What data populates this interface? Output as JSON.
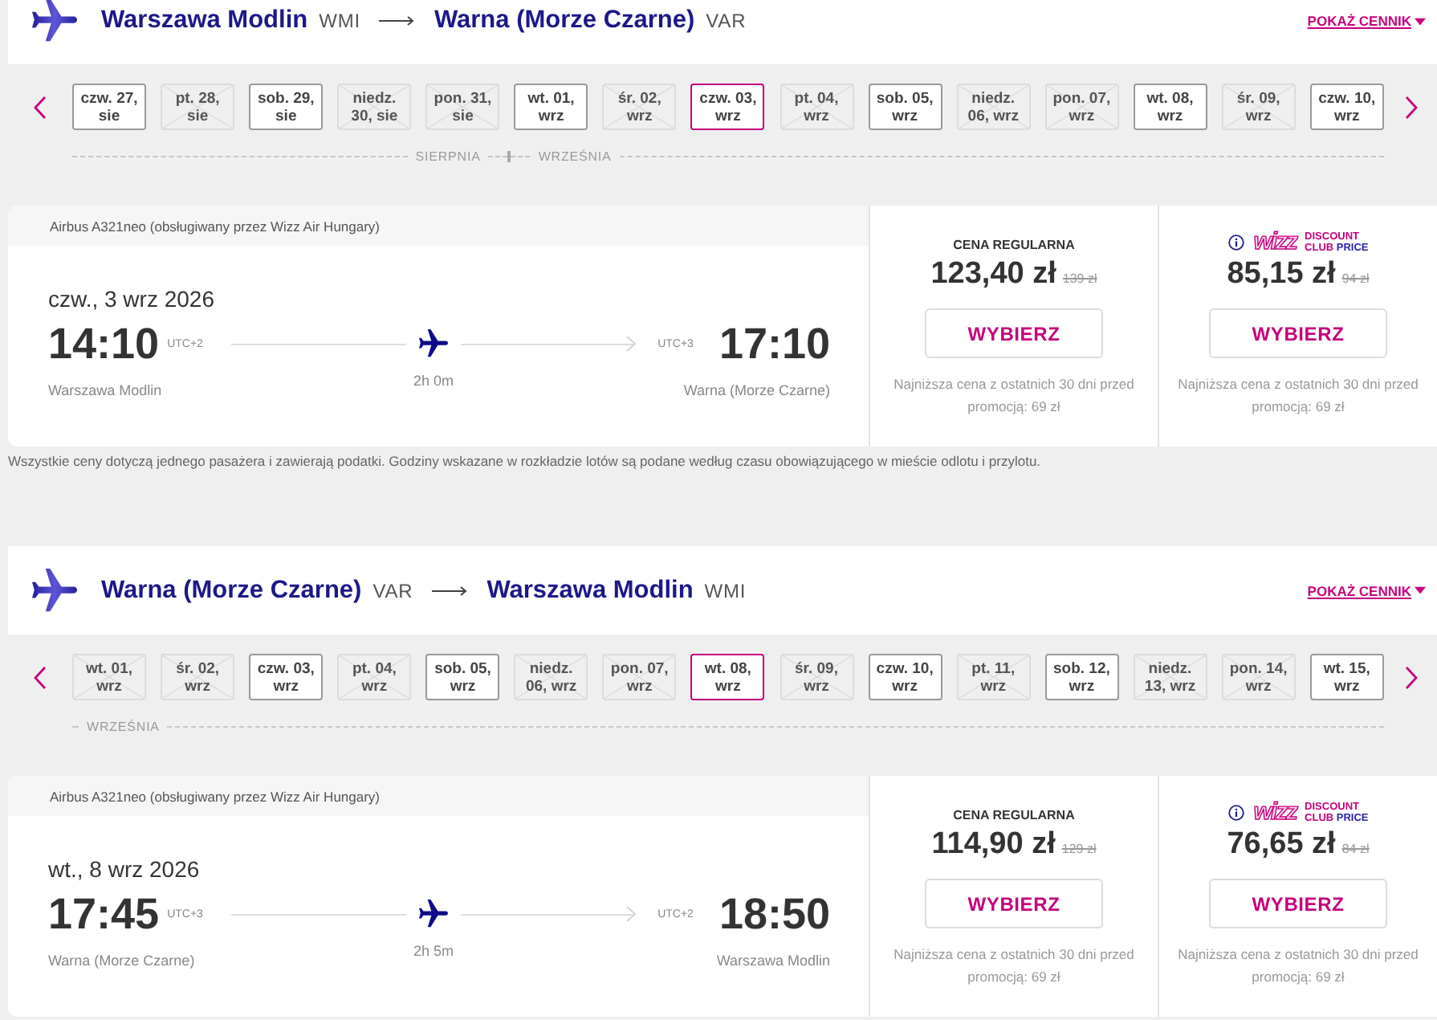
{
  "sections": [
    {
      "route": {
        "origin": {
          "city": "Warszawa Modlin",
          "code": "WMI"
        },
        "destination": {
          "city": "Warna (Morze Czarne)",
          "code": "VAR"
        }
      },
      "price_list_link": "POKAŻ CENNIK",
      "months": [
        {
          "label": "SIERPNIA",
          "days": [
            {
              "label": "czw. 27, sie",
              "available": true,
              "selected": false
            },
            {
              "label": "pt. 28, sie",
              "available": false,
              "selected": false
            },
            {
              "label": "sob. 29, sie",
              "available": true,
              "selected": false
            },
            {
              "label": "niedz. 30, sie",
              "available": false,
              "selected": false
            },
            {
              "label": "pon. 31, sie",
              "available": false,
              "selected": false
            }
          ]
        },
        {
          "label": "WRZEŚNIA",
          "days": [
            {
              "label": "wt. 01, wrz",
              "available": true,
              "selected": false
            },
            {
              "label": "śr. 02, wrz",
              "available": false,
              "selected": false
            },
            {
              "label": "czw. 03, wrz",
              "available": true,
              "selected": true
            },
            {
              "label": "pt. 04, wrz",
              "available": false,
              "selected": false
            },
            {
              "label": "sob. 05, wrz",
              "available": true,
              "selected": false
            },
            {
              "label": "niedz. 06, wrz",
              "available": false,
              "selected": false
            },
            {
              "label": "pon. 07, wrz",
              "available": false,
              "selected": false
            },
            {
              "label": "wt. 08, wrz",
              "available": true,
              "selected": false
            },
            {
              "label": "śr. 09, wrz",
              "available": false,
              "selected": false
            },
            {
              "label": "czw. 10, wrz",
              "available": true,
              "selected": false
            }
          ]
        }
      ],
      "flight": {
        "aircraft": "Airbus A321neo (obsługiwany przez Wizz Air Hungary)",
        "date": "czw., 3 wrz 2026",
        "departure": {
          "time": "14:10",
          "utc": "UTC+2",
          "airport": "Warszawa Modlin"
        },
        "duration": "2h 0m",
        "arrival": {
          "time": "17:10",
          "utc": "UTC+3",
          "airport": "Warna (Morze Czarne)"
        },
        "fares": [
          {
            "kind": "regular",
            "title": "CENA REGULARNA",
            "price": "123,40 zł",
            "old_price": "139 zł",
            "button": "WYBIERZ",
            "note": "Najniższa cena z ostatnich 30 dni przed promocją: 69 zł"
          },
          {
            "kind": "club",
            "logo": {
              "mark": "wizz",
              "line_1": "DISCOUNT",
              "line_2": "CLUB",
              "line_2_accent": "PRICE"
            },
            "price": "85,15 zł",
            "old_price": "94 zł",
            "button": "WYBIERZ",
            "note": "Najniższa cena z ostatnich 30 dni przed promocją: 69 zł"
          }
        ]
      },
      "footnote": "Wszystkie ceny dotyczą jednego pasażera i zawierają podatki. Godziny wskazane w rozkładzie lotów są podane według czasu obowiązującego w mieście odlotu i przylotu."
    },
    {
      "route": {
        "origin": {
          "city": "Warna (Morze Czarne)",
          "code": "VAR"
        },
        "destination": {
          "city": "Warszawa Modlin",
          "code": "WMI"
        }
      },
      "price_list_link": "POKAŻ CENNIK",
      "months": [
        {
          "label": "WRZEŚNIA",
          "days": [
            {
              "label": "wt. 01, wrz",
              "available": false,
              "selected": false
            },
            {
              "label": "śr. 02, wrz",
              "available": false,
              "selected": false
            },
            {
              "label": "czw. 03, wrz",
              "available": true,
              "selected": false
            },
            {
              "label": "pt. 04, wrz",
              "available": false,
              "selected": false
            },
            {
              "label": "sob. 05, wrz",
              "available": true,
              "selected": false
            },
            {
              "label": "niedz. 06, wrz",
              "available": false,
              "selected": false
            },
            {
              "label": "pon. 07, wrz",
              "available": false,
              "selected": false
            },
            {
              "label": "wt. 08, wrz",
              "available": true,
              "selected": true
            },
            {
              "label": "śr. 09, wrz",
              "available": false,
              "selected": false
            },
            {
              "label": "czw. 10, wrz",
              "available": true,
              "selected": false
            },
            {
              "label": "pt. 11, wrz",
              "available": false,
              "selected": false
            },
            {
              "label": "sob. 12, wrz",
              "available": true,
              "selected": false
            },
            {
              "label": "niedz. 13, wrz",
              "available": false,
              "selected": false
            },
            {
              "label": "pon. 14, wrz",
              "available": false,
              "selected": false
            },
            {
              "label": "wt. 15, wrz",
              "available": true,
              "selected": false
            }
          ]
        }
      ],
      "flight": {
        "aircraft": "Airbus A321neo (obsługiwany przez Wizz Air Hungary)",
        "date": "wt., 8 wrz 2026",
        "departure": {
          "time": "17:45",
          "utc": "UTC+3",
          "airport": "Warna (Morze Czarne)"
        },
        "duration": "2h 5m",
        "arrival": {
          "time": "18:50",
          "utc": "UTC+2",
          "airport": "Warszawa Modlin"
        },
        "fares": [
          {
            "kind": "regular",
            "title": "CENA REGULARNA",
            "price": "114,90 zł",
            "old_price": "129 zł",
            "button": "WYBIERZ",
            "note": "Najniższa cena z ostatnich 30 dni przed promocją: 69 zł"
          },
          {
            "kind": "club",
            "logo": {
              "mark": "wizz",
              "line_1": "DISCOUNT",
              "line_2": "CLUB",
              "line_2_accent": "PRICE"
            },
            "price": "76,65 zł",
            "old_price": "84 zł",
            "button": "WYBIERZ",
            "note": "Najniższa cena z ostatnich 30 dni przed promocją: 69 zł"
          }
        ]
      }
    }
  ]
}
